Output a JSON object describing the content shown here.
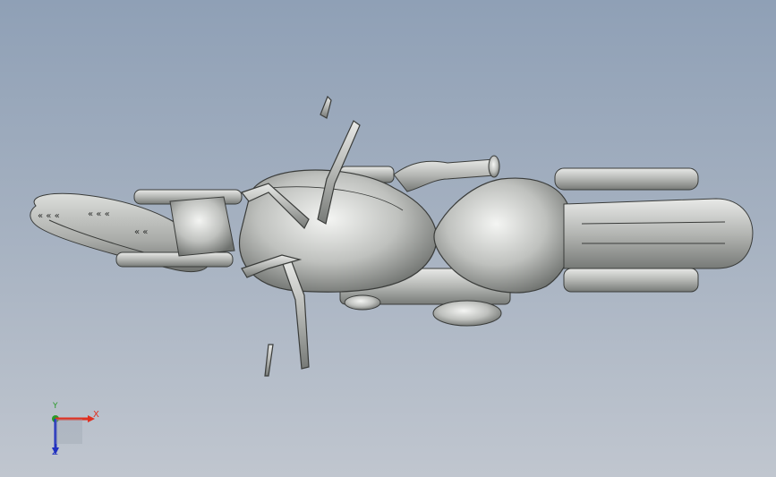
{
  "viewport": {
    "background_top": "#8fa0b6",
    "background_bottom": "#c0c6cf",
    "model_color": "#c7c9c6"
  },
  "model": {
    "icon": "motorcycle-top-view",
    "label": ""
  },
  "triad": {
    "x_label": "X",
    "y_label": "Y",
    "z_label": "Z",
    "x_color": "#e03020",
    "y_color": "#2a9a2a",
    "z_color": "#2030c0"
  }
}
